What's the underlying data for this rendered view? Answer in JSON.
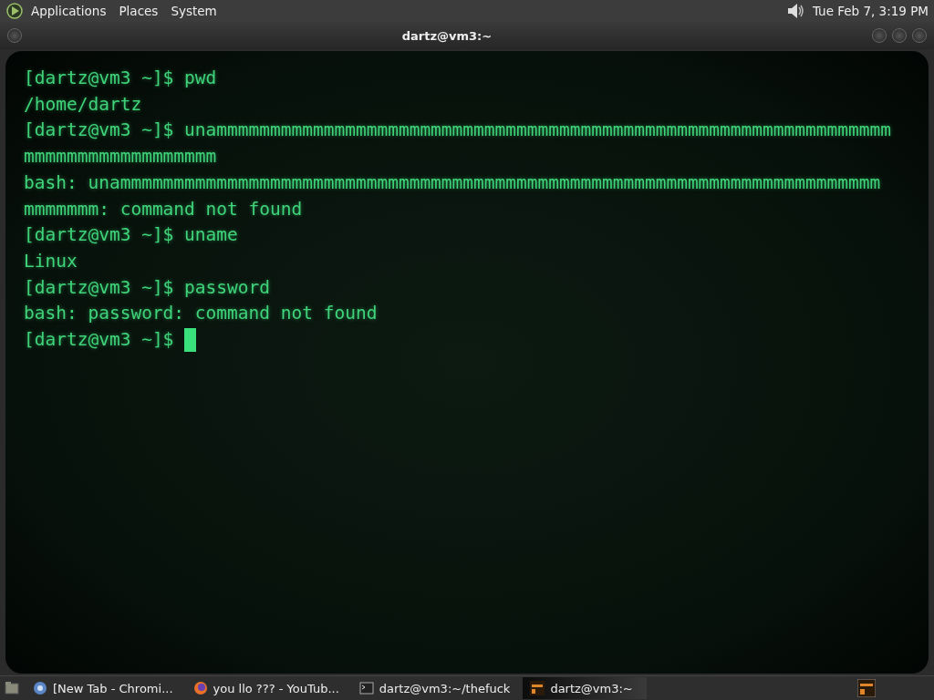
{
  "panel": {
    "menus": [
      "Applications",
      "Places",
      "System"
    ],
    "clock": "Tue Feb  7, 3:19 PM"
  },
  "window": {
    "title": "dartz@vm3:~"
  },
  "terminal": {
    "lines": [
      "[dartz@vm3 ~]$ pwd",
      "/home/dartz",
      "[dartz@vm3 ~]$ unammmmmmmmmmmmmmmmmmmmmmmmmmmmmmmmmmmmmmmmmmmmmmmmmmmmmmmmmmmmmmm",
      "mmmmmmmmmmmmmmmmmm",
      "bash: unammmmmmmmmmmmmmmmmmmmmmmmmmmmmmmmmmmmmmmmmmmmmmmmmmmmmmmmmmmmmmmmmmmmmmm",
      "mmmmmmm: command not found",
      "[dartz@vm3 ~]$ uname",
      "Linux",
      "[dartz@vm3 ~]$ password",
      "bash: password: command not found"
    ],
    "prompt": "[dartz@vm3 ~]$",
    "cursor": true
  },
  "taskbar": {
    "tasks": [
      {
        "kind": "browser",
        "label": "[New Tab - Chromi...",
        "selected": false
      },
      {
        "kind": "firefox",
        "label": "you llo ??? - YouTub...",
        "selected": false
      },
      {
        "kind": "terminal",
        "label": "dartz@vm3:~/thefuck",
        "selected": false
      },
      {
        "kind": "crt",
        "label": "dartz@vm3:~",
        "selected": true
      }
    ]
  }
}
